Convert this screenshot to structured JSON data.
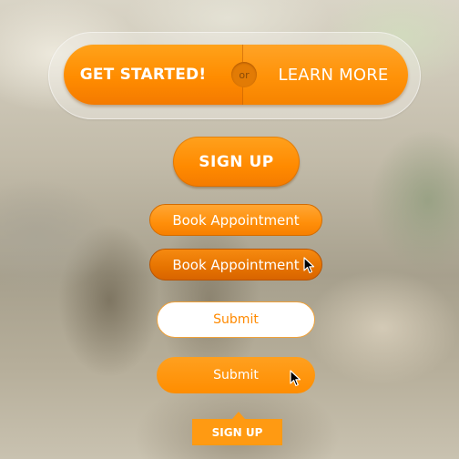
{
  "segmented": {
    "left_label": "GET STARTED!",
    "separator": "or",
    "right_label": "LEARN MORE"
  },
  "signup_large": {
    "label": "SIGN UP"
  },
  "book_buttons": [
    {
      "label": "Book Appointment",
      "state": "normal"
    },
    {
      "label": "Book Appointment",
      "state": "hover"
    }
  ],
  "submit_buttons": [
    {
      "label": "Submit",
      "style": "outline"
    },
    {
      "label": "Submit",
      "style": "filled-hover"
    }
  ],
  "signup_small": {
    "label": "SIGN UP"
  },
  "colors": {
    "accent": "#ff8c00",
    "accent_dark": "#e67300",
    "white": "#ffffff"
  },
  "icons": [
    "mouse-pointer-icon",
    "mouse-pointer-icon"
  ]
}
